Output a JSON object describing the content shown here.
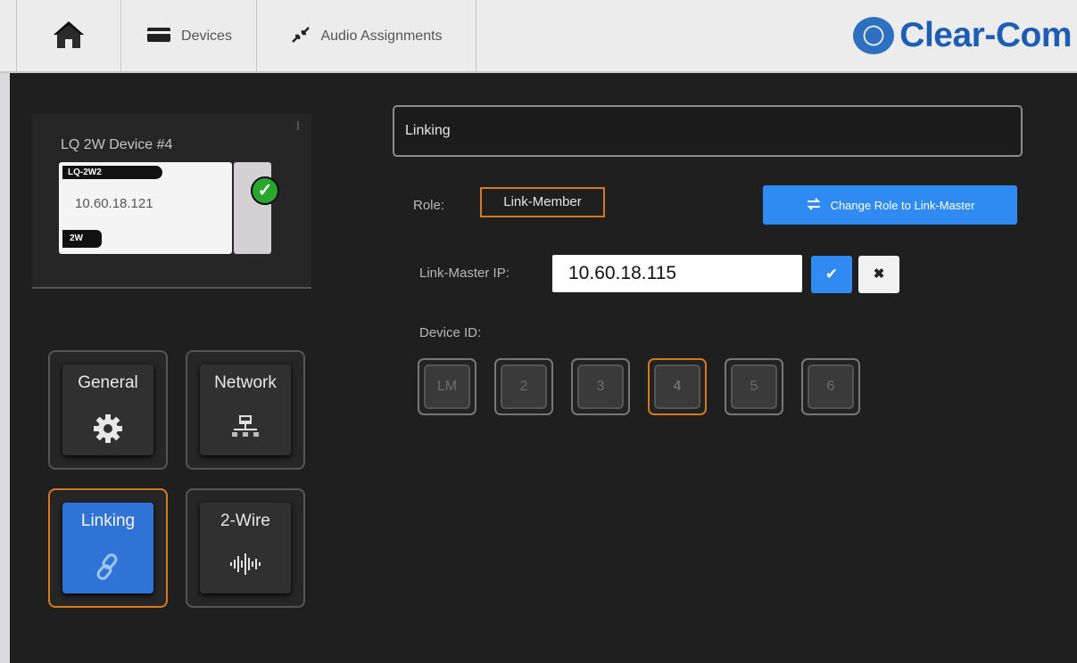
{
  "topbar": {
    "home_icon": "home-icon",
    "devices_label": "Devices",
    "devices_icon": "card-icon",
    "audio_label": "Audio Assignments",
    "audio_icon": "arrows-diagonal-icon",
    "brand": "Clear-Com",
    "brand_color": "#1d5db5"
  },
  "device": {
    "title": "LQ 2W Device #4",
    "model": "LQ-2W2",
    "ip": "10.60.18.121",
    "type": "2W",
    "status_icon": "check-circle-icon"
  },
  "menu": {
    "general_label": "General",
    "network_label": "Network",
    "linking_label": "Linking",
    "twowire_label": "2-Wire"
  },
  "linking": {
    "header": "Linking",
    "role_label": "Role:",
    "role_value": "Link-Member",
    "change_role_label": "Change Role to Link-Master",
    "link_master_ip_label": "Link-Master IP:",
    "link_master_ip_value": "10.60.18.115",
    "confirm_icon": "check-icon",
    "cancel_icon": "close-icon",
    "device_id_label": "Device ID:",
    "device_ids": [
      "LM",
      "2",
      "3",
      "4",
      "5",
      "6"
    ],
    "selected_device_id": "4"
  },
  "colors": {
    "accent_blue": "#2f8bf2",
    "selected_orange": "#d27a1c",
    "background": "#1f1f20"
  }
}
